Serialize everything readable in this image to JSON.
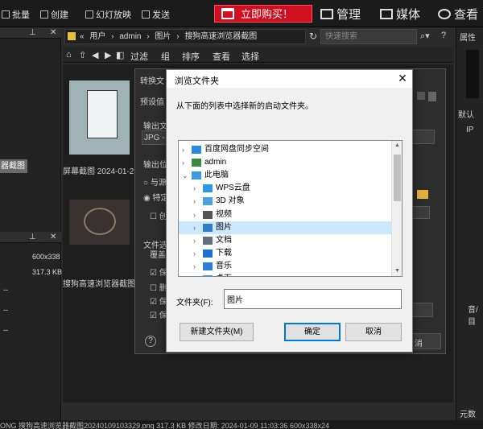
{
  "toolbar": {
    "batch": "批量",
    "create": "创建",
    "slideshow": "幻灯放映",
    "send": "发送",
    "buy_now": "立即购买！",
    "manage": "管理",
    "media": "媒体",
    "view": "查看"
  },
  "address": {
    "path": [
      "«",
      "用户",
      "admin",
      "图片",
      "搜狗高速浏览器截图"
    ],
    "search_placeholder": "快速搜索"
  },
  "nav": {
    "items": [
      "过滤",
      "组",
      "排序",
      "查看",
      "选择"
    ]
  },
  "left_panel": {
    "selected_folder": "器截图",
    "dims": "600x338",
    "size": "317.3 KB",
    "dash_rows": [
      "--",
      "--",
      "--"
    ]
  },
  "thumbnails": [
    {
      "caption": "屏幕截图 2024-01-2"
    },
    {
      "caption": "搜狗高速浏览器截图"
    }
  ],
  "right_panel": {
    "attr": "属性",
    "default": "默认",
    "ip": "IP",
    "vol": "音/目",
    "data": "元数据"
  },
  "status_bar": {
    "text": "ONG   搜狗高速浏览器截图20240109103329.png     317.3 KB  修改日期: 2024-01-09 11:03:36    600x338x24"
  },
  "convert_dialog": {
    "title": "转换文",
    "preset": "预设值",
    "output_format_label": "输出文",
    "format_value": "JPG - J",
    "output_location_label": "输出位",
    "opt_same": "与源",
    "opt_specific": "特定",
    "create_check": "创",
    "file_opts": "文件选",
    "overwrite": "覆盖",
    "check_keep1": "保",
    "check_del": "删",
    "check_keep2": "保",
    "check_keep3": "保",
    "help": "?",
    "cancel_partial": "消"
  },
  "browse_dialog": {
    "title": "浏览文件夹",
    "close": "✕",
    "message": "从下面的列表中选择新的启动文件夹。",
    "tree": [
      {
        "label": "百度网盘同步空间",
        "indent": 0,
        "expanded": false,
        "icon": "cloud-sync-icon",
        "color": "#2b8be0"
      },
      {
        "label": "admin",
        "indent": 0,
        "expanded": false,
        "icon": "user-icon",
        "color": "#3a8a3a"
      },
      {
        "label": "此电脑",
        "indent": 0,
        "expanded": true,
        "icon": "computer-icon",
        "color": "#3a9be0"
      },
      {
        "label": "WPS云盘",
        "indent": 1,
        "expanded": false,
        "icon": "cloud-icon",
        "color": "#2b9be8"
      },
      {
        "label": "3D 对象",
        "indent": 1,
        "expanded": false,
        "icon": "cube-icon",
        "color": "#4aa0e0"
      },
      {
        "label": "视频",
        "indent": 1,
        "expanded": false,
        "icon": "video-icon",
        "color": "#555555"
      },
      {
        "label": "图片",
        "indent": 1,
        "expanded": false,
        "icon": "picture-icon",
        "color": "#2f7fc8",
        "selected": true
      },
      {
        "label": "文档",
        "indent": 1,
        "expanded": false,
        "icon": "document-icon",
        "color": "#607080"
      },
      {
        "label": "下载",
        "indent": 1,
        "expanded": false,
        "icon": "download-icon",
        "color": "#1f6fd0"
      },
      {
        "label": "音乐",
        "indent": 1,
        "expanded": false,
        "icon": "music-icon",
        "color": "#2f7fd8"
      },
      {
        "label": "桌面",
        "indent": 1,
        "expanded": false,
        "icon": "desktop-icon",
        "color": "#3a9be0"
      }
    ],
    "folder_label": "文件夹(F):",
    "folder_value": "图片",
    "new_folder": "新建文件夹(M)",
    "ok": "确定",
    "cancel": "取消"
  }
}
